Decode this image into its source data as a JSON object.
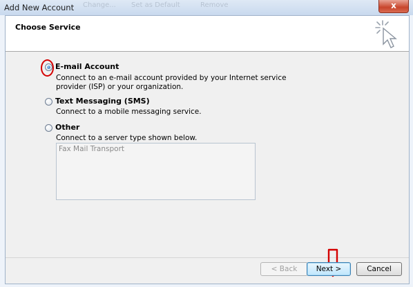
{
  "window": {
    "title": "Add New Account",
    "ghost_items": [
      "Change...",
      "Set as Default",
      "Remove"
    ],
    "close_glyph": "x"
  },
  "header": {
    "title": "Choose Service",
    "icon": "wizard-cursor-icon"
  },
  "options": [
    {
      "label": "E-mail Account",
      "description": "Connect to an e-mail account provided by your Internet service provider (ISP) or your organization.",
      "checked": true
    },
    {
      "label": "Text Messaging (SMS)",
      "description": "Connect to a mobile messaging service.",
      "checked": false
    },
    {
      "label": "Other",
      "description": "Connect to a server type shown below.",
      "checked": false
    }
  ],
  "server_list": {
    "items": [
      "Fax Mail Transport"
    ]
  },
  "buttons": {
    "back": "< Back",
    "next": "Next >",
    "cancel": "Cancel"
  },
  "annotation_colors": {
    "highlight": "#d40000"
  }
}
